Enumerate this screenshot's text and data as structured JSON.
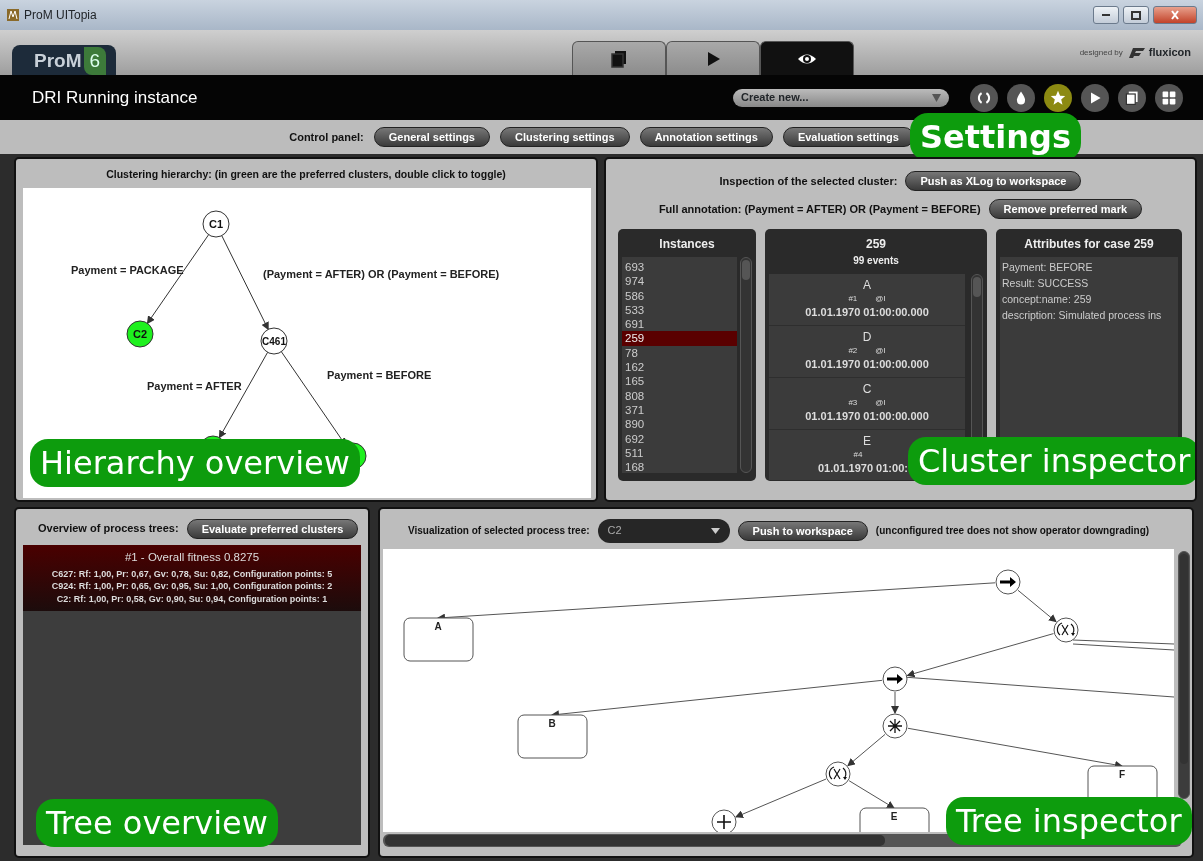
{
  "window": {
    "title": "ProM UITopia"
  },
  "app": {
    "logo_text": "ProM",
    "logo_version": "6",
    "designed_by": "designed by",
    "brand": "fluxicon"
  },
  "view_tabs": [
    {
      "kind": "copy",
      "selected": false
    },
    {
      "kind": "play",
      "selected": false
    },
    {
      "kind": "eye",
      "selected": true
    }
  ],
  "toolbar": {
    "title": "DRI Running instance",
    "create_select": "Create new...",
    "actions": [
      {
        "kind": "refresh",
        "selected": false
      },
      {
        "kind": "drop",
        "selected": false
      },
      {
        "kind": "star",
        "selected": true
      },
      {
        "kind": "play",
        "selected": false
      },
      {
        "kind": "copy",
        "selected": false
      },
      {
        "kind": "grid",
        "selected": false
      }
    ]
  },
  "control_panel": {
    "label": "Control panel:",
    "buttons": [
      "General settings",
      "Clustering settings",
      "Annotation settings",
      "Evaluation settings"
    ]
  },
  "hierarchy": {
    "title": "Clustering hierarchy: (in green are the preferred clusters, double click to toggle)",
    "root": {
      "label": "C1",
      "preferred": false,
      "children": [
        {
          "label": "C2",
          "preferred": true,
          "edge_label": "Payment = PACKAGE"
        },
        {
          "label": "C461",
          "preferred": false,
          "edge_label": "(Payment = AFTER) OR (Payment = BEFORE)",
          "children": [
            {
              "preferred": true,
              "edge_label": "Payment = AFTER"
            },
            {
              "preferred": true,
              "edge_label": "Payment = BEFORE"
            }
          ]
        }
      ]
    }
  },
  "cluster_inspector": {
    "label": "Inspection of the selected cluster:",
    "push_button": "Push as XLog to workspace",
    "annotation": "Full annotation: (Payment = AFTER) OR (Payment = BEFORE)",
    "remove_button": "Remove preferred mark",
    "instances": {
      "title": "Instances",
      "items": [
        {
          "label": "693",
          "selected": false
        },
        {
          "label": "974",
          "selected": false
        },
        {
          "label": "586",
          "selected": false
        },
        {
          "label": "533",
          "selected": false
        },
        {
          "label": "691",
          "selected": false
        },
        {
          "label": "259",
          "selected": true
        },
        {
          "label": "78",
          "selected": false
        },
        {
          "label": "162",
          "selected": false
        },
        {
          "label": "165",
          "selected": false
        },
        {
          "label": "808",
          "selected": false
        },
        {
          "label": "371",
          "selected": false
        },
        {
          "label": "890",
          "selected": false
        },
        {
          "label": "692",
          "selected": false
        },
        {
          "label": "511",
          "selected": false
        },
        {
          "label": "168",
          "selected": false
        }
      ]
    },
    "trace": {
      "title": "259",
      "subtitle": "99 events",
      "events": [
        {
          "name": "A",
          "index": "#1",
          "lifecycle": "@I",
          "time": "01.01.1970 01:00:00.000"
        },
        {
          "name": "D",
          "index": "#2",
          "lifecycle": "@I",
          "time": "01.01.1970 01:00:00.000"
        },
        {
          "name": "C",
          "index": "#3",
          "lifecycle": "@I",
          "time": "01.01.1970 01:00:00.000"
        },
        {
          "name": "E",
          "index": "#4",
          "time": "01.01.1970 01:00:"
        }
      ]
    },
    "attributes": {
      "title": "Attributes for case 259",
      "lines": [
        "Payment: BEFORE",
        "Result: SUCCESS",
        "concept:name: 259",
        "description: Simulated process ins"
      ]
    }
  },
  "tree_overview": {
    "label": "Overview of process trees:",
    "button": "Evaluate preferred clusters",
    "results": [
      {
        "title": "#1 - Overall fitness 0.8275",
        "selected": true,
        "lines": [
          "C627: Rf: 1,00, Pr: 0,67, Gv: 0,78, Su: 0,82, Configuration points: 5",
          "C924: Rf: 1,00, Pr: 0,65, Gv: 0,95, Su: 1,00, Configuration points: 2",
          "C2: Rf: 1,00, Pr: 0,58, Gv: 0,90, Su: 0,94, Configuration points: 1"
        ]
      }
    ]
  },
  "tree_inspector": {
    "label": "Visualization of selected process tree:",
    "tree_select": "C2",
    "push_button": "Push to workspace",
    "note": "(unconfigured tree does not show operator downgrading)",
    "root": {
      "kind": "seq",
      "children": [
        {
          "kind": "activity",
          "label": "A"
        },
        {
          "kind": "xor_loop",
          "children": [
            {
              "kind": "seq",
              "children": [
                {
                  "kind": "activity",
                  "label": "B"
                },
                {
                  "kind": "and",
                  "children": [
                    {
                      "kind": "xor_loop",
                      "children": [
                        {
                          "kind": "or"
                        },
                        {
                          "kind": "activity",
                          "label": "E"
                        }
                      ]
                    },
                    {
                      "kind": "activity",
                      "label": "F"
                    }
                  ]
                }
              ]
            }
          ]
        }
      ]
    }
  },
  "callouts": [
    {
      "text": "Settings"
    },
    {
      "text": "Hierarchy overview"
    },
    {
      "text": "Cluster inspector"
    },
    {
      "text": "Tree overview"
    },
    {
      "text": "Tree inspector"
    }
  ]
}
